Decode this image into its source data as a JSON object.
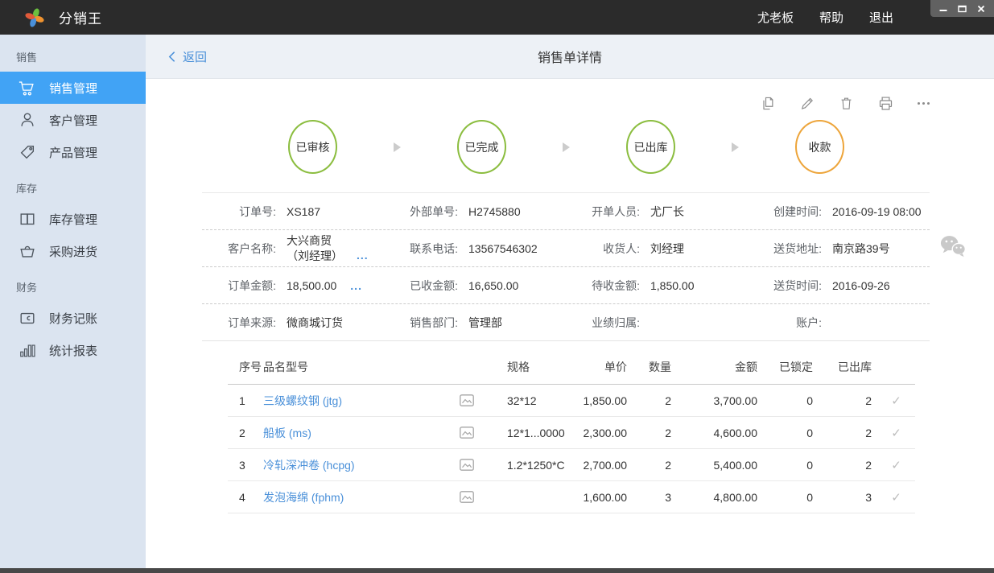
{
  "titlebar": {
    "app_name": "分销王",
    "user": "尤老板",
    "help": "帮助",
    "logout": "退出"
  },
  "sidebar": {
    "sections": [
      {
        "header": "销售",
        "items": [
          {
            "label": "销售管理",
            "icon": "cart-icon",
            "active": true
          },
          {
            "label": "客户管理",
            "icon": "person-icon"
          },
          {
            "label": "产品管理",
            "icon": "tag-icon"
          }
        ]
      },
      {
        "header": "库存",
        "items": [
          {
            "label": "库存管理",
            "icon": "book-icon"
          },
          {
            "label": "采购进货",
            "icon": "basket-icon"
          }
        ]
      },
      {
        "header": "财务",
        "items": [
          {
            "label": "财务记账",
            "icon": "wallet-icon"
          },
          {
            "label": "统计报表",
            "icon": "bar-chart-icon"
          }
        ]
      }
    ]
  },
  "header": {
    "back_label": "返回",
    "title": "销售单详情"
  },
  "toolbar": {
    "icons": [
      "copy-icon",
      "edit-icon",
      "delete-icon",
      "print-icon",
      "more-icon"
    ]
  },
  "status_flow": {
    "steps": [
      {
        "label": "已审核",
        "color": "#8bbd3f"
      },
      {
        "label": "已完成",
        "color": "#8bbd3f"
      },
      {
        "label": "已出库",
        "color": "#8bbd3f"
      },
      {
        "label": "收款",
        "color": "#eda53b"
      }
    ]
  },
  "order_info": {
    "order_no": {
      "label": "订单号:",
      "value": "XS187"
    },
    "external_no": {
      "label": "外部单号:",
      "value": "H2745880"
    },
    "creator": {
      "label": "开单人员:",
      "value": "尤厂长"
    },
    "created_time": {
      "label": "创建时间:",
      "value": "2016-09-19 08:00"
    },
    "customer": {
      "label": "客户名称:",
      "value_line1": "大兴商贸",
      "value_line2": "（刘经理）",
      "more": "..."
    },
    "phone": {
      "label": "联系电话:",
      "value": "13567546302"
    },
    "receiver": {
      "label": "收货人:",
      "value": "刘经理"
    },
    "address": {
      "label": "送货地址:",
      "value": "南京路39号"
    },
    "order_amount": {
      "label": "订单金额:",
      "value": "18,500.00",
      "more": "..."
    },
    "received_amount": {
      "label": "已收金额:",
      "value": "16,650.00"
    },
    "pending_amount": {
      "label": "待收金额:",
      "value": "1,850.00"
    },
    "delivery_time": {
      "label": "送货时间:",
      "value": "2016-09-26"
    },
    "source": {
      "label": "订单来源:",
      "value": "微商城订货"
    },
    "department": {
      "label": "销售部门:",
      "value": "管理部"
    },
    "attribution": {
      "label": "业绩归属:",
      "value": ""
    },
    "account": {
      "label": "账户:",
      "value": ""
    }
  },
  "items_table": {
    "columns": [
      "序号",
      "品名型号",
      "规格",
      "单价",
      "数量",
      "金额",
      "已锁定",
      "已出库"
    ],
    "check_glyph": "✓",
    "rows": [
      {
        "no": "1",
        "name": "三级螺纹钢 (jtg)",
        "spec": "32*12",
        "price": "1,850.00",
        "qty": "2",
        "amount": "3,700.00",
        "locked": "0",
        "shipped": "2"
      },
      {
        "no": "2",
        "name": "船板 (ms)",
        "spec": "12*1...0000",
        "price": "2,300.00",
        "qty": "2",
        "amount": "4,600.00",
        "locked": "0",
        "shipped": "2"
      },
      {
        "no": "3",
        "name": "冷轧深冲卷 (hcpg)",
        "spec": "1.2*1250*C",
        "price": "2,700.00",
        "qty": "2",
        "amount": "5,400.00",
        "locked": "0",
        "shipped": "2"
      },
      {
        "no": "4",
        "name": "发泡海绵 (fphm)",
        "spec": "",
        "price": "1,600.00",
        "qty": "3",
        "amount": "4,800.00",
        "locked": "0",
        "shipped": "3"
      }
    ]
  },
  "colors": {
    "titlebar_bg": "#2b2b2b",
    "sidebar_bg": "#dbe4f0",
    "accent_blue": "#41a3f5",
    "link_blue": "#4a90d9",
    "step_green": "#8bbd3f",
    "step_orange": "#eda53b"
  }
}
